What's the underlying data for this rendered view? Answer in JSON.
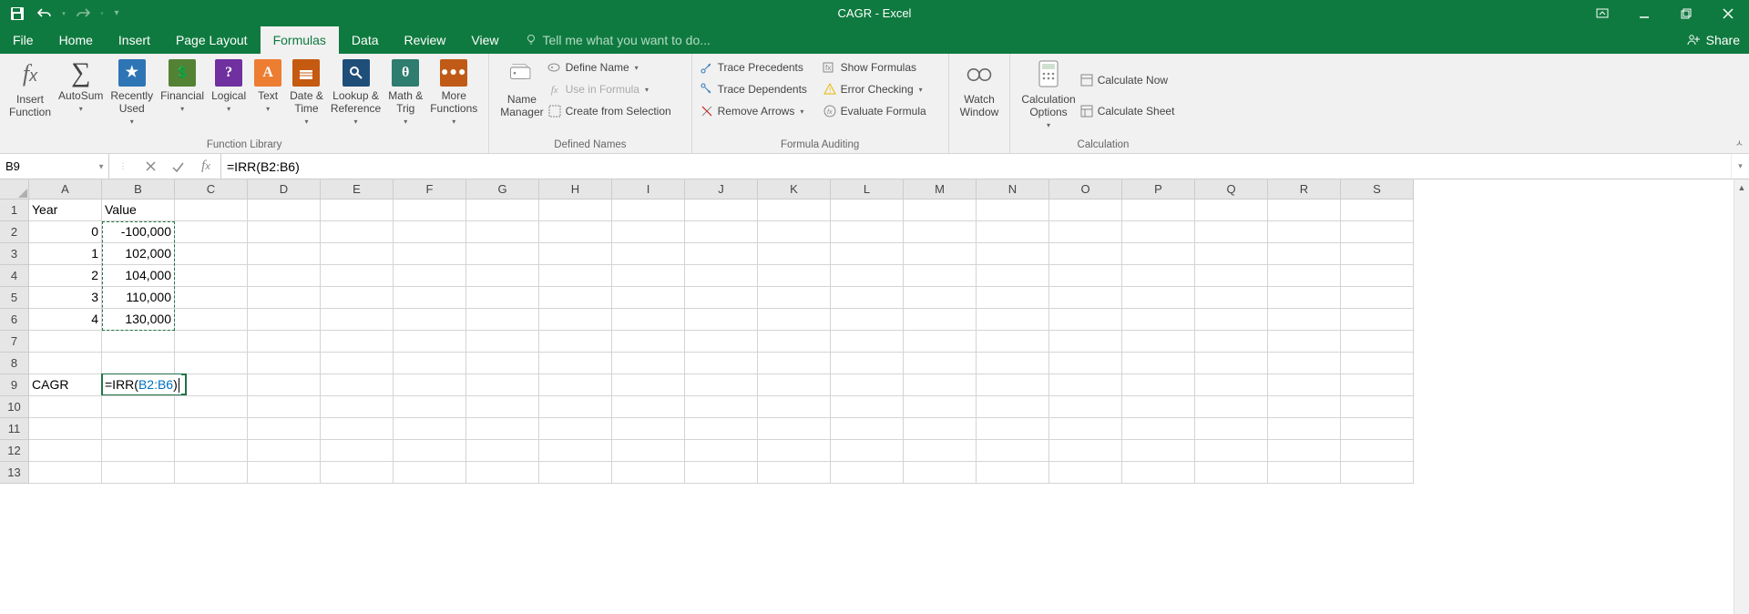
{
  "title": "CAGR - Excel",
  "tabs": {
    "file": "File",
    "home": "Home",
    "insert": "Insert",
    "pagelayout": "Page Layout",
    "formulas": "Formulas",
    "data": "Data",
    "review": "Review",
    "view": "View",
    "tellme": "Tell me what you want to do...",
    "share": "Share"
  },
  "ribbon": {
    "insertfn": "Insert\nFunction",
    "autosum": "AutoSum",
    "recent": "Recently\nUsed",
    "financial": "Financial",
    "logical": "Logical",
    "text": "Text",
    "datetime": "Date &\nTime",
    "lookup": "Lookup &\nReference",
    "mathtrig": "Math &\nTrig",
    "morefn": "More\nFunctions",
    "grp_funclib": "Function Library",
    "namemgr": "Name\nManager",
    "definename": "Define Name",
    "useinformula": "Use in Formula",
    "createfromsel": "Create from Selection",
    "grp_defnames": "Defined Names",
    "traceprec": "Trace Precedents",
    "tracedep": "Trace Dependents",
    "removearr": "Remove Arrows",
    "showformulas": "Show Formulas",
    "errorcheck": "Error Checking",
    "evalformula": "Evaluate Formula",
    "grp_audit": "Formula Auditing",
    "watch": "Watch\nWindow",
    "calcopts": "Calculation\nOptions",
    "calcnow": "Calculate Now",
    "calcsheet": "Calculate Sheet",
    "grp_calc": "Calculation"
  },
  "namebox": "B9",
  "formula": "=IRR(B2:B6)",
  "columns": [
    "A",
    "B",
    "C",
    "D",
    "E",
    "F",
    "G",
    "H",
    "I",
    "J",
    "K",
    "L",
    "M",
    "N",
    "O",
    "P",
    "Q",
    "R",
    "S"
  ],
  "rows": [
    "1",
    "2",
    "3",
    "4",
    "5",
    "6",
    "7",
    "8",
    "9",
    "10",
    "11",
    "12",
    "13"
  ],
  "cells": {
    "A1": "Year",
    "B1": "Value",
    "A2": "0",
    "B2": "-100,000",
    "A3": "1",
    "B3": "102,000",
    "A4": "2",
    "B4": "104,000",
    "A5": "3",
    "B5": "110,000",
    "A6": "4",
    "B6": "130,000",
    "A9": "CAGR"
  },
  "editcell": {
    "pre": "=IRR(",
    "ref": "B2:B6",
    "post": ")"
  }
}
